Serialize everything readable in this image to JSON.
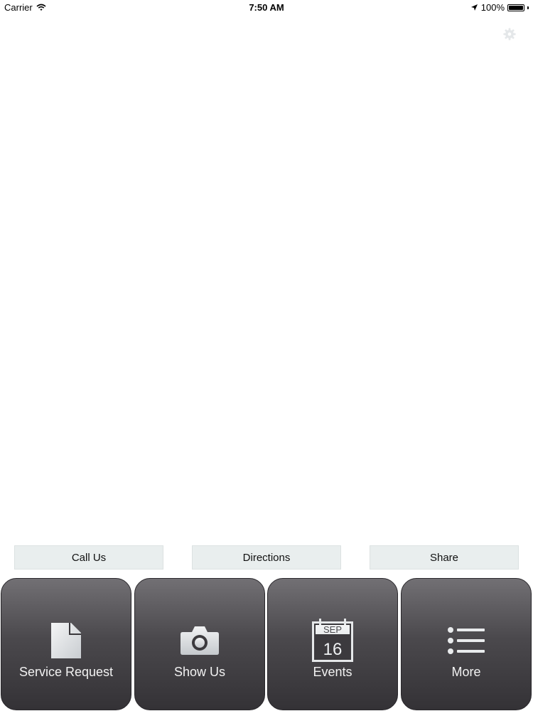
{
  "status_bar": {
    "carrier": "Carrier",
    "time": "7:50 AM",
    "battery": "100%",
    "icons": [
      "wifi-icon",
      "location-arrow-icon",
      "battery-icon"
    ]
  },
  "header": {
    "settings_icon": "gear-icon"
  },
  "actions": {
    "call": "Call Us",
    "directions": "Directions",
    "share": "Share"
  },
  "tabs": [
    {
      "label": "Service Request",
      "icon": "document-icon"
    },
    {
      "label": "Show Us",
      "icon": "camera-icon"
    },
    {
      "label": "Events",
      "icon": "calendar-icon",
      "calendar_month": "SEP",
      "calendar_day": "16"
    },
    {
      "label": "More",
      "icon": "list-icon"
    }
  ],
  "colors": {
    "tab_top": "#727074",
    "tab_bottom": "#343236",
    "action_button_bg": "#e9eeee"
  }
}
